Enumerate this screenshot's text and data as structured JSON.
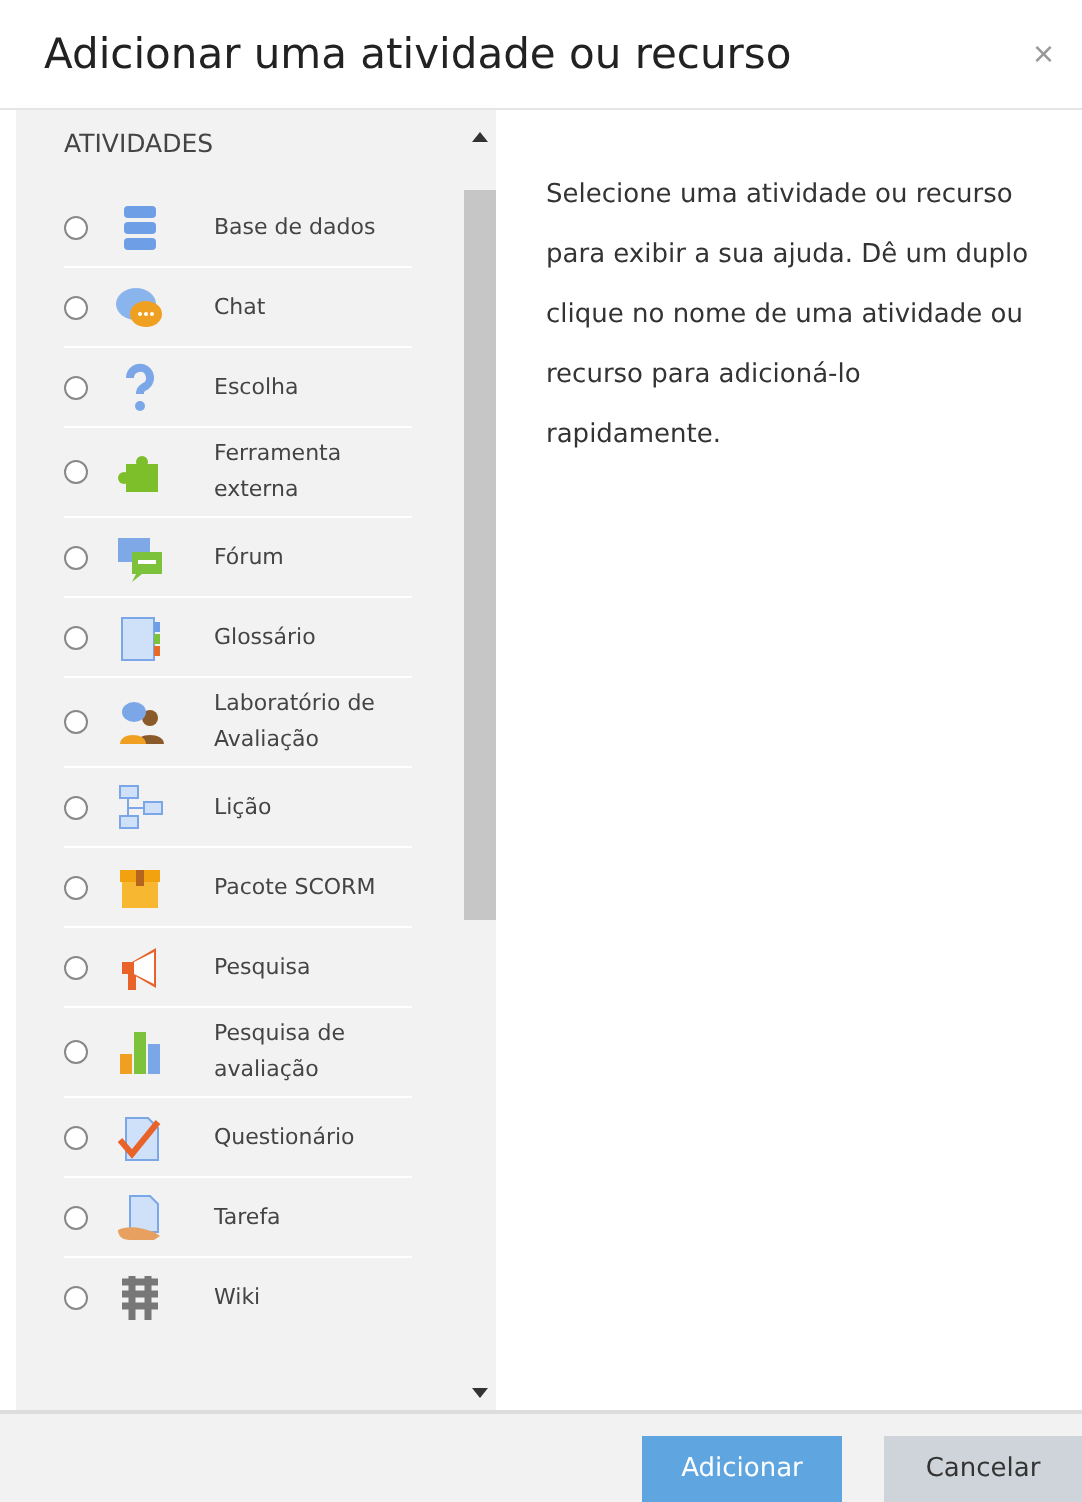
{
  "dialog": {
    "title": "Adicionar uma atividade ou recurso",
    "close": "×"
  },
  "list": {
    "heading": "ATIVIDADES",
    "items": [
      {
        "label": "Base de dados",
        "selected": false
      },
      {
        "label": "Chat",
        "selected": false
      },
      {
        "label": "Escolha",
        "selected": false
      },
      {
        "label": "Ferramenta externa",
        "selected": false
      },
      {
        "label": "Fórum",
        "selected": false
      },
      {
        "label": "Glossário",
        "selected": false
      },
      {
        "label": "Laboratório de Avaliação",
        "selected": false
      },
      {
        "label": "Lição",
        "selected": false
      },
      {
        "label": "Pacote SCORM",
        "selected": false
      },
      {
        "label": "Pesquisa",
        "selected": false
      },
      {
        "label": "Pesquisa de avaliação",
        "selected": false
      },
      {
        "label": "Questionário",
        "selected": false
      },
      {
        "label": "Tarefa",
        "selected": false
      },
      {
        "label": "Wiki",
        "selected": false
      }
    ]
  },
  "help": "Selecione uma atividade ou recurso para exibir a sua ajuda. Dê um duplo clique no nome de uma atividade ou recurso para adicioná-lo rapidamente.",
  "buttons": [
    {
      "label": "Adicionar",
      "kind": "primary"
    },
    {
      "label": "Cancelar",
      "kind": "secondary"
    }
  ]
}
